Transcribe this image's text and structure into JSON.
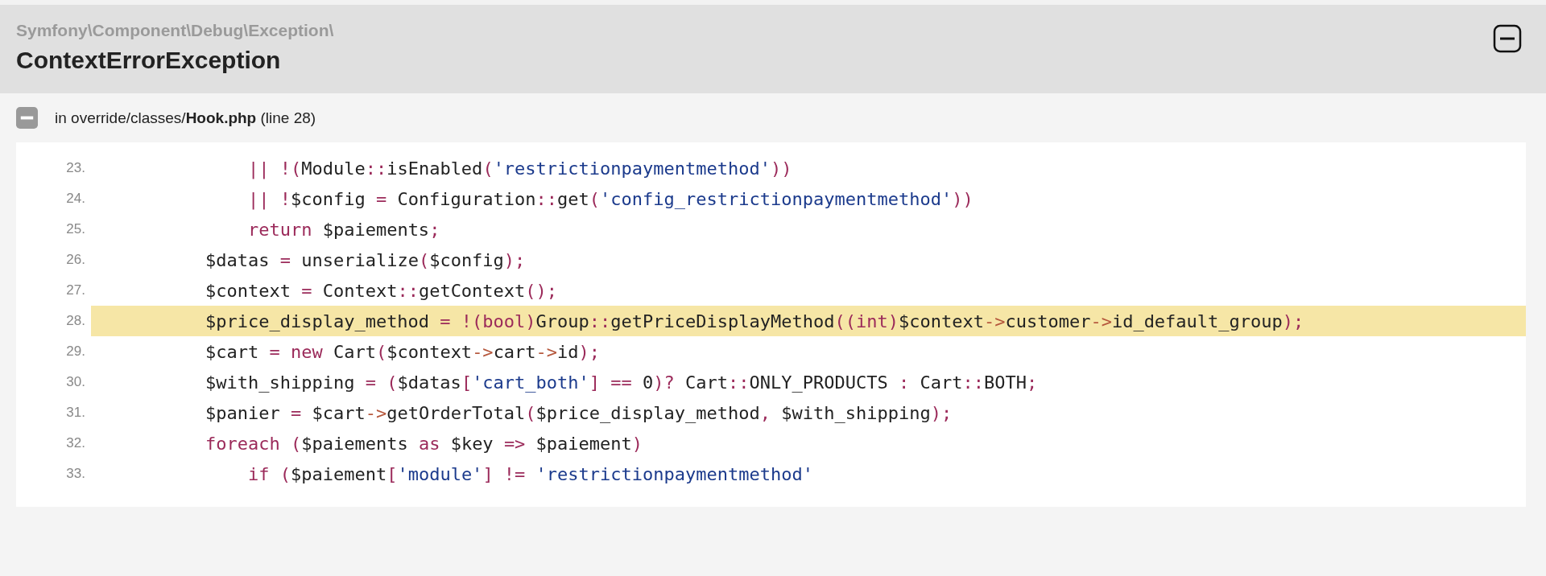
{
  "exception": {
    "namespace": "Symfony\\Component\\Debug\\Exception\\",
    "title": "ContextErrorException",
    "expanded": true
  },
  "trace": {
    "location": "in override/classes/**Hook.php** (line 28)",
    "expanded": true
  },
  "code_lines": [
    {
      "number": "23.",
      "highlighted": false,
      "tokens": [
        {
          "text": "            || !(",
          "kind": "op"
        },
        {
          "text": "Module",
          "kind": "plain"
        },
        {
          "text": "::",
          "kind": "op"
        },
        {
          "text": "isEnabled",
          "kind": "plain"
        },
        {
          "text": "(",
          "kind": "op"
        },
        {
          "text": "'restrictionpaymentmethod'",
          "kind": "string"
        },
        {
          "text": "))",
          "kind": "op"
        }
      ]
    },
    {
      "number": "24.",
      "highlighted": false,
      "tokens": [
        {
          "text": "            || !",
          "kind": "op"
        },
        {
          "text": "$config ",
          "kind": "plain"
        },
        {
          "text": "=",
          "kind": "op"
        },
        {
          "text": " Configuration",
          "kind": "plain"
        },
        {
          "text": "::",
          "kind": "op"
        },
        {
          "text": "get",
          "kind": "plain"
        },
        {
          "text": "(",
          "kind": "op"
        },
        {
          "text": "'config_restrictionpaymentmethod'",
          "kind": "string"
        },
        {
          "text": "))",
          "kind": "op"
        }
      ]
    },
    {
      "number": "25.",
      "highlighted": false,
      "tokens": [
        {
          "text": "            return",
          "kind": "op"
        },
        {
          "text": " $paiements",
          "kind": "plain"
        },
        {
          "text": ";",
          "kind": "op"
        }
      ]
    },
    {
      "number": "26.",
      "highlighted": false,
      "tokens": [
        {
          "text": "        $datas ",
          "kind": "plain"
        },
        {
          "text": "=",
          "kind": "op"
        },
        {
          "text": " unserialize",
          "kind": "plain"
        },
        {
          "text": "(",
          "kind": "op"
        },
        {
          "text": "$config",
          "kind": "plain"
        },
        {
          "text": ");",
          "kind": "op"
        }
      ]
    },
    {
      "number": "27.",
      "highlighted": false,
      "tokens": [
        {
          "text": "        $context ",
          "kind": "plain"
        },
        {
          "text": "=",
          "kind": "op"
        },
        {
          "text": " Context",
          "kind": "plain"
        },
        {
          "text": "::",
          "kind": "op"
        },
        {
          "text": "getContext",
          "kind": "plain"
        },
        {
          "text": "();",
          "kind": "op"
        }
      ]
    },
    {
      "number": "28.",
      "highlighted": true,
      "tokens": [
        {
          "text": "        $price_display_method ",
          "kind": "plain"
        },
        {
          "text": "= !(bool)",
          "kind": "op"
        },
        {
          "text": "Group",
          "kind": "plain"
        },
        {
          "text": "::",
          "kind": "op"
        },
        {
          "text": "getPriceDisplayMethod",
          "kind": "plain"
        },
        {
          "text": "((int)",
          "kind": "op"
        },
        {
          "text": "$context",
          "kind": "plain"
        },
        {
          "text": "->",
          "kind": "arrow"
        },
        {
          "text": "customer",
          "kind": "plain"
        },
        {
          "text": "->",
          "kind": "arrow"
        },
        {
          "text": "id_default_group",
          "kind": "plain"
        },
        {
          "text": ");",
          "kind": "op"
        }
      ]
    },
    {
      "number": "29.",
      "highlighted": false,
      "tokens": [
        {
          "text": "        $cart ",
          "kind": "plain"
        },
        {
          "text": "=",
          "kind": "op"
        },
        {
          "text": " new",
          "kind": "op"
        },
        {
          "text": " Cart",
          "kind": "plain"
        },
        {
          "text": "(",
          "kind": "op"
        },
        {
          "text": "$context",
          "kind": "plain"
        },
        {
          "text": "->",
          "kind": "arrow"
        },
        {
          "text": "cart",
          "kind": "plain"
        },
        {
          "text": "->",
          "kind": "arrow"
        },
        {
          "text": "id",
          "kind": "plain"
        },
        {
          "text": ");",
          "kind": "op"
        }
      ]
    },
    {
      "number": "30.",
      "highlighted": false,
      "tokens": [
        {
          "text": "        $with_shipping ",
          "kind": "plain"
        },
        {
          "text": "= (",
          "kind": "op"
        },
        {
          "text": "$datas",
          "kind": "plain"
        },
        {
          "text": "[",
          "kind": "op"
        },
        {
          "text": "'cart_both'",
          "kind": "string"
        },
        {
          "text": "] ==",
          "kind": "op"
        },
        {
          "text": " 0",
          "kind": "plain"
        },
        {
          "text": ")?",
          "kind": "op"
        },
        {
          "text": " Cart",
          "kind": "plain"
        },
        {
          "text": "::",
          "kind": "op"
        },
        {
          "text": "ONLY_PRODUCTS ",
          "kind": "plain"
        },
        {
          "text": ":",
          "kind": "op"
        },
        {
          "text": " Cart",
          "kind": "plain"
        },
        {
          "text": "::",
          "kind": "op"
        },
        {
          "text": "BOTH",
          "kind": "plain"
        },
        {
          "text": ";",
          "kind": "op"
        }
      ]
    },
    {
      "number": "31.",
      "highlighted": false,
      "tokens": [
        {
          "text": "        $panier ",
          "kind": "plain"
        },
        {
          "text": "=",
          "kind": "op"
        },
        {
          "text": " $cart",
          "kind": "plain"
        },
        {
          "text": "->",
          "kind": "arrow"
        },
        {
          "text": "getOrderTotal",
          "kind": "plain"
        },
        {
          "text": "(",
          "kind": "op"
        },
        {
          "text": "$price_display_method",
          "kind": "plain"
        },
        {
          "text": ",",
          "kind": "op"
        },
        {
          "text": " $with_shipping",
          "kind": "plain"
        },
        {
          "text": ");",
          "kind": "op"
        }
      ]
    },
    {
      "number": "32.",
      "highlighted": false,
      "tokens": [
        {
          "text": "        foreach",
          "kind": "op"
        },
        {
          "text": " (",
          "kind": "op"
        },
        {
          "text": "$paiements ",
          "kind": "plain"
        },
        {
          "text": "as",
          "kind": "op"
        },
        {
          "text": " $key ",
          "kind": "plain"
        },
        {
          "text": "=>",
          "kind": "op"
        },
        {
          "text": " $paiement",
          "kind": "plain"
        },
        {
          "text": ")",
          "kind": "op"
        }
      ]
    },
    {
      "number": "33.",
      "highlighted": false,
      "tokens": [
        {
          "text": "            if",
          "kind": "op"
        },
        {
          "text": " (",
          "kind": "op"
        },
        {
          "text": "$paiement",
          "kind": "plain"
        },
        {
          "text": "[",
          "kind": "op"
        },
        {
          "text": "'module'",
          "kind": "string"
        },
        {
          "text": "] !=",
          "kind": "op"
        },
        {
          "text": " 'restrictionpaymentmethod'",
          "kind": "string"
        }
      ]
    }
  ]
}
